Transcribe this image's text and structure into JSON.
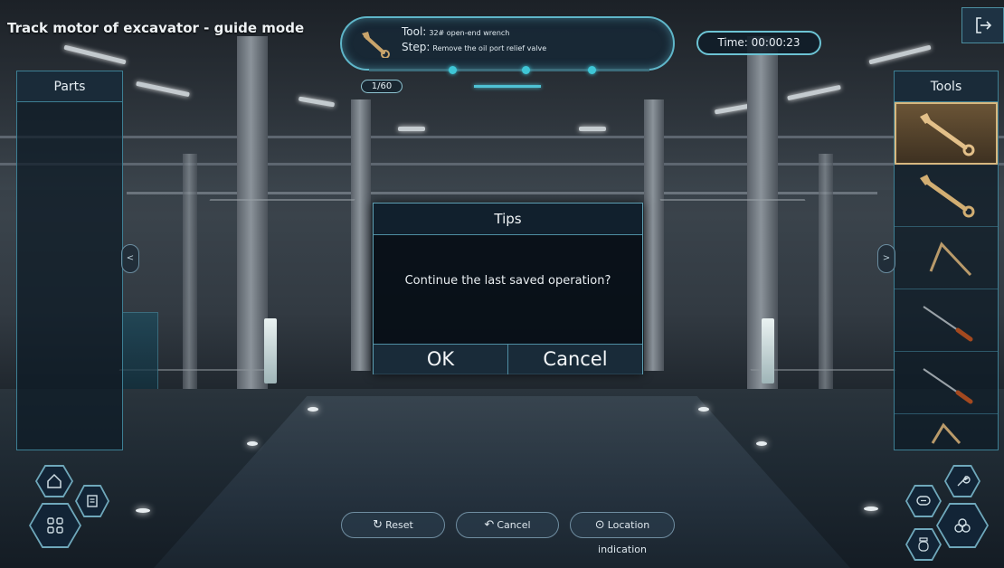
{
  "header": {
    "title": "Track motor of excavator - guide mode"
  },
  "info": {
    "tool_label": "Tool:",
    "tool_value": "32# open-end wrench",
    "step_label": "Step:",
    "step_value": "Remove the oil port relief valve",
    "step_counter": "1/60"
  },
  "timer": {
    "text": "Time: 00:00:23"
  },
  "parts_panel": {
    "title": "Parts"
  },
  "tools_panel": {
    "title": "Tools",
    "items": [
      {
        "icon": "open-end-wrench-icon",
        "selected": true
      },
      {
        "icon": "open-end-wrench-icon",
        "selected": false
      },
      {
        "icon": "hex-key-icon",
        "selected": false
      },
      {
        "icon": "screwdriver-icon",
        "selected": false
      },
      {
        "icon": "screwdriver-icon",
        "selected": false
      },
      {
        "icon": "hex-key-icon",
        "selected": false
      }
    ]
  },
  "dialog": {
    "title": "Tips",
    "message": "Continue the last saved operation?",
    "ok_label": "OK",
    "cancel_label": "Cancel"
  },
  "bottom_bar": {
    "reset_label": "Reset",
    "cancel_label": "Cancel",
    "location_label": "Location indication"
  },
  "colors": {
    "accent": "#5fb6c9",
    "progress": "#3fc6d6",
    "selected_tool": "#d7b77e"
  }
}
